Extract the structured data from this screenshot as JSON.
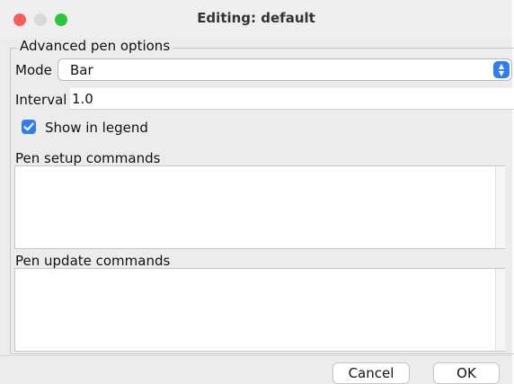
{
  "window": {
    "title": "Editing: default"
  },
  "advanced": {
    "group_title": "Advanced pen options",
    "mode_label": "Mode",
    "mode_value": "Bar",
    "interval_label": "Interval",
    "interval_value": "1.0",
    "show_in_legend_label": "Show in legend",
    "show_in_legend_checked": true
  },
  "commands": {
    "setup_label": "Pen setup commands",
    "setup_value": "",
    "update_label": "Pen update commands",
    "update_value": ""
  },
  "buttons": {
    "cancel": "Cancel",
    "ok": "OK"
  },
  "colors": {
    "accent": "#2f7cf6",
    "close": "#fd5d58",
    "minimize_disabled": "#d9d9d9",
    "zoom": "#2dc53e"
  }
}
